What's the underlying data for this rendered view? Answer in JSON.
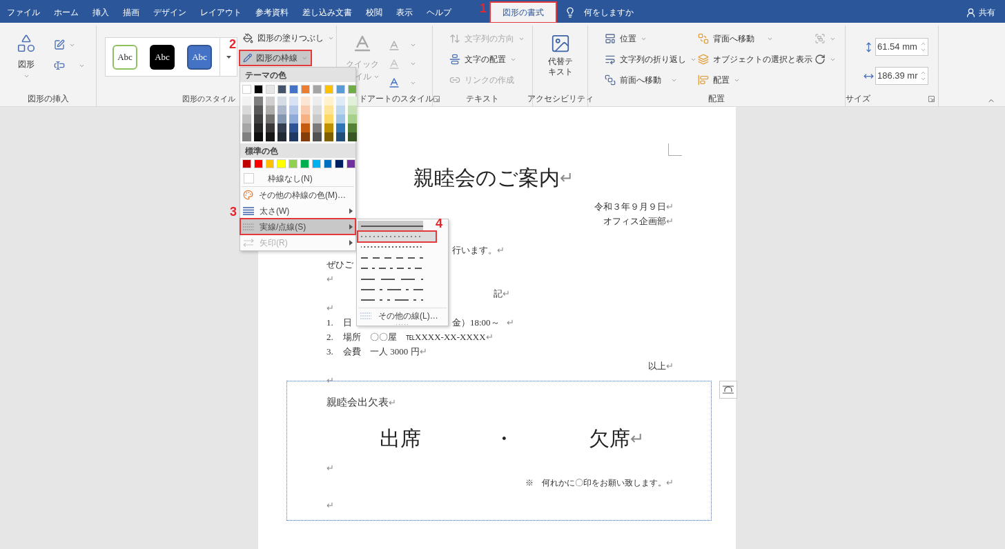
{
  "tabs": [
    {
      "label": "ファイル",
      "selected": false,
      "outlined": false
    },
    {
      "label": "ホーム",
      "selected": false,
      "outlined": false
    },
    {
      "label": "挿入",
      "selected": false,
      "outlined": false
    },
    {
      "label": "描画",
      "selected": false,
      "outlined": false
    },
    {
      "label": "デザイン",
      "selected": false,
      "outlined": false
    },
    {
      "label": "レイアウト",
      "selected": false,
      "outlined": false
    },
    {
      "label": "参考資料",
      "selected": false,
      "outlined": false
    },
    {
      "label": "差し込み文書",
      "selected": false,
      "outlined": false
    },
    {
      "label": "校閲",
      "selected": false,
      "outlined": false
    },
    {
      "label": "表示",
      "selected": false,
      "outlined": false
    },
    {
      "label": "ヘルプ",
      "selected": false,
      "outlined": false
    },
    {
      "label": "図形の書式",
      "selected": true,
      "outlined": true
    }
  ],
  "tell_me": "何をしますか",
  "share": "共有",
  "ribbon": {
    "groups": [
      {
        "kind": "insert-shapes",
        "label": "図形の挿入",
        "shapes_button": "図形"
      },
      {
        "kind": "shape-styles",
        "label": "図形のスタイル",
        "swatches": [
          {
            "text": "Abc",
            "color": "#ffffff"
          },
          {
            "text": "Abc",
            "color": "#000000"
          },
          {
            "text": "Abc",
            "color": "#4472c4"
          }
        ],
        "fill_button": "図形の塗りつぶし",
        "outline_button": {
          "label": "図形の枠線",
          "pressed": true,
          "outlined": true
        }
      },
      {
        "kind": "wordart",
        "label": "ドアートのスタイル",
        "quick_style": [
          "クイック",
          "イル"
        ]
      },
      {
        "kind": "text",
        "label": "テキスト",
        "buttons": [
          {
            "label": "文字列の方向",
            "disabled": true,
            "dropdown": true
          },
          {
            "label": "文字の配置",
            "disabled": false,
            "dropdown": true
          },
          {
            "label": "リンクの作成",
            "disabled": true,
            "dropdown": false
          }
        ]
      },
      {
        "kind": "accessibility",
        "label": "アクセシビリティ",
        "button": "代替テキスト"
      },
      {
        "kind": "arrange",
        "label": "配置",
        "left": [
          "位置",
          "文字列の折り返し",
          "前面へ移動"
        ],
        "right": [
          "背面へ移動",
          "オブジェクトの選択と表示",
          "配置"
        ]
      },
      {
        "kind": "size",
        "label": "サイズ",
        "height": "61.54 mm",
        "width": "186.39 mr"
      }
    ]
  },
  "outline_menu": {
    "theme_heading": "テーマの色",
    "theme_colors": [
      {
        "color": "#ffffff",
        "shades": [
          {
            "color": "#f2f2f2"
          },
          {
            "color": "#d9d9d9"
          },
          {
            "color": "#bfbfbf"
          },
          {
            "color": "#a6a6a6"
          },
          {
            "color": "#808080"
          }
        ]
      },
      {
        "color": "#000000",
        "shades": [
          {
            "color": "#7f7f7f"
          },
          {
            "color": "#595959"
          },
          {
            "color": "#404040"
          },
          {
            "color": "#262626"
          },
          {
            "color": "#0d0d0d"
          }
        ]
      },
      {
        "color": "#e7e6e6",
        "shades": [
          {
            "color": "#d0cece"
          },
          {
            "color": "#aeabab"
          },
          {
            "color": "#757171"
          },
          {
            "color": "#3a3838"
          },
          {
            "color": "#171616"
          }
        ]
      },
      {
        "color": "#44546a",
        "shades": [
          {
            "color": "#d6dce4"
          },
          {
            "color": "#adb9ca"
          },
          {
            "color": "#8497b0"
          },
          {
            "color": "#333f4f"
          },
          {
            "color": "#222a35"
          }
        ]
      },
      {
        "color": "#4472c4",
        "shades": [
          {
            "color": "#d9e2f3"
          },
          {
            "color": "#b4c6e7"
          },
          {
            "color": "#8eaadb"
          },
          {
            "color": "#2f5496"
          },
          {
            "color": "#1f3864"
          }
        ]
      },
      {
        "color": "#ed7d31",
        "shades": [
          {
            "color": "#fbe5d5"
          },
          {
            "color": "#f7cbac"
          },
          {
            "color": "#f4b183"
          },
          {
            "color": "#c55a11"
          },
          {
            "color": "#843c0b"
          }
        ]
      },
      {
        "color": "#a5a5a5",
        "shades": [
          {
            "color": "#ededed"
          },
          {
            "color": "#dbdbdb"
          },
          {
            "color": "#c9c9c9"
          },
          {
            "color": "#7b7b7b"
          },
          {
            "color": "#525252"
          }
        ]
      },
      {
        "color": "#ffc000",
        "shades": [
          {
            "color": "#fff2cc"
          },
          {
            "color": "#ffe599"
          },
          {
            "color": "#ffd966"
          },
          {
            "color": "#bf9000"
          },
          {
            "color": "#7f6000"
          }
        ]
      },
      {
        "color": "#5b9bd5",
        "shades": [
          {
            "color": "#deebf6"
          },
          {
            "color": "#bdd7ee"
          },
          {
            "color": "#9dc3e6"
          },
          {
            "color": "#2e75b5"
          },
          {
            "color": "#1f4e79"
          }
        ]
      },
      {
        "color": "#70ad47",
        "shades": [
          {
            "color": "#e2efd9"
          },
          {
            "color": "#c5e0b3"
          },
          {
            "color": "#a8d08d"
          },
          {
            "color": "#538135"
          },
          {
            "color": "#375623"
          }
        ]
      }
    ],
    "standard_heading": "標準の色",
    "standard_colors": [
      {
        "color": "#c00000"
      },
      {
        "color": "#ff0000"
      },
      {
        "color": "#ffc000"
      },
      {
        "color": "#ffff00"
      },
      {
        "color": "#92d050"
      },
      {
        "color": "#00b050"
      },
      {
        "color": "#00b0f0"
      },
      {
        "color": "#0070c0"
      },
      {
        "color": "#002060"
      },
      {
        "color": "#7030a0"
      }
    ],
    "items": [
      {
        "kind": "no-outline",
        "label": "枠線なし(N)",
        "selected": false,
        "disabled": false,
        "outlined": false,
        "submenu": false
      },
      {
        "kind": "more-colors",
        "label": "その他の枠線の色(M)…",
        "selected": false,
        "disabled": false,
        "outlined": false,
        "submenu": false
      },
      {
        "kind": "weight",
        "label": "太さ(W)",
        "selected": false,
        "disabled": false,
        "outlined": false,
        "submenu": true
      },
      {
        "kind": "dashes",
        "label": "実線/点線(S)",
        "selected": true,
        "disabled": false,
        "outlined": true,
        "submenu": true
      },
      {
        "kind": "arrows",
        "label": "矢印(R)",
        "selected": false,
        "disabled": true,
        "outlined": false,
        "submenu": true
      }
    ]
  },
  "dash_menu": {
    "styles": [
      {
        "kind": "solid",
        "current": true,
        "selected": false,
        "outlined": false
      },
      {
        "kind": "square-dot",
        "current": false,
        "selected": true,
        "outlined": true
      },
      {
        "kind": "round-dot",
        "current": false,
        "selected": false,
        "outlined": false
      },
      {
        "kind": "dash",
        "current": false,
        "selected": false,
        "outlined": false
      },
      {
        "kind": "dash-dot",
        "current": false,
        "selected": false,
        "outlined": false
      },
      {
        "kind": "long-dash",
        "current": false,
        "selected": false,
        "outlined": false
      },
      {
        "kind": "long-dash-dot",
        "current": false,
        "selected": false,
        "outlined": false
      },
      {
        "kind": "long-dash-dot-dot",
        "current": false,
        "selected": false,
        "outlined": false
      }
    ],
    "more": "その他の線(L)…"
  },
  "annotations": [
    {
      "label": "1"
    },
    {
      "label": "2"
    },
    {
      "label": "3"
    },
    {
      "label": "4"
    }
  ],
  "document": {
    "paragraphs": [
      {
        "kind": "title",
        "text": "親睦会のご案内",
        "return_mark": "↵"
      },
      {
        "kind": "right",
        "text": "令和３年９月９日",
        "return_mark": "↵"
      },
      {
        "kind": "right",
        "text": "オフィス企画部",
        "return_mark": "↵"
      },
      {
        "kind": "offset",
        "text": "行います。",
        "return_mark": "↵"
      },
      {
        "kind": "left",
        "text": "ぜひご"
      },
      {
        "kind": "left",
        "return_mark": "↵"
      },
      {
        "kind": "center",
        "text": "記",
        "return_mark": "↵"
      },
      {
        "kind": "left",
        "return_mark": "↵"
      },
      {
        "kind": "list",
        "number": "1.",
        "text": "日",
        "tail": "金）18:00～",
        "return_mark": "↵"
      },
      {
        "kind": "list",
        "number": "2.",
        "text": "場所　〇〇屋　℡XXXX-XX-XXXX",
        "return_mark": "↵"
      },
      {
        "kind": "list",
        "number": "3.",
        "text": "会費　一人 3000 円",
        "return_mark": "↵"
      },
      {
        "kind": "right",
        "text": "以上",
        "return_mark": "↵"
      },
      {
        "kind": "left",
        "return_mark": "↵"
      }
    ],
    "text_box": [
      {
        "kind": "left",
        "text": "親睦会出欠表",
        "return_mark": "↵"
      },
      {
        "kind": "choices",
        "items": [
          "出席",
          "・",
          "欠席"
        ],
        "return_mark": "↵"
      },
      {
        "kind": "left",
        "return_mark": "↵"
      },
      {
        "kind": "right",
        "text": "※　何れかに〇印をお願い致します。",
        "return_mark": "↵"
      },
      {
        "kind": "left",
        "return_mark": "↵"
      }
    ]
  }
}
